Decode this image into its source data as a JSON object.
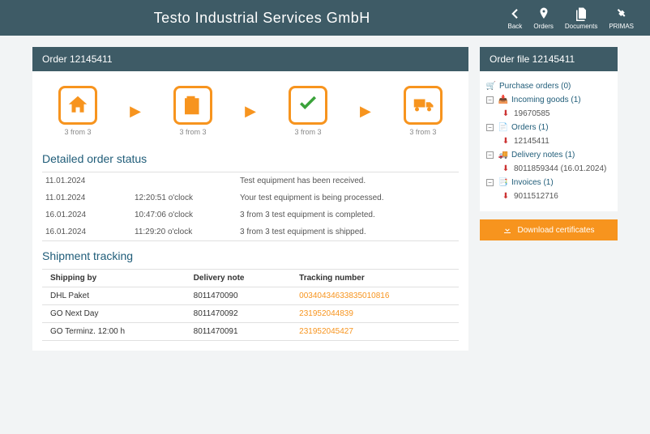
{
  "header": {
    "title": "Testo Industrial Services GmbH",
    "buttons": {
      "back": "Back",
      "orders": "Orders",
      "documents": "Documents",
      "primas": "PRIMAS"
    }
  },
  "order": {
    "panel_title": "Order 12145411",
    "steps": {
      "s0": "3 from 3",
      "s1": "3 from 3",
      "s2": "3 from 3",
      "s3": "3 from 3"
    },
    "detail_title": "Detailed order status",
    "status": {
      "r0": {
        "date": "11.01.2024",
        "time": "",
        "msg": "Test equipment has been received."
      },
      "r1": {
        "date": "11.01.2024",
        "time": "12:20:51 o'clock",
        "msg": "Your test equipment is being processed."
      },
      "r2": {
        "date": "16.01.2024",
        "time": "10:47:06 o'clock",
        "msg": "3 from 3 test equipment is completed."
      },
      "r3": {
        "date": "16.01.2024",
        "time": "11:29:20 o'clock",
        "msg": "3 from 3 test equipment is shipped."
      }
    },
    "ship_title": "Shipment tracking",
    "ship_headers": {
      "h0": "Shipping by",
      "h1": "Delivery note",
      "h2": "Tracking number"
    },
    "shipments": {
      "r0": {
        "carrier": "DHL Paket",
        "note": "8011470090",
        "tracking": "00340434633835010816"
      },
      "r1": {
        "carrier": "GO Next Day",
        "note": "8011470092",
        "tracking": "231952044839"
      },
      "r2": {
        "carrier": "GO Terminz. 12:00 h",
        "note": "8011470091",
        "tracking": "231952045427"
      }
    }
  },
  "file": {
    "panel_title": "Order file 12145411",
    "tree": {
      "po": "Purchase orders (0)",
      "incoming": "Incoming goods (1)",
      "incoming_child": "19670585",
      "orders": "Orders (1)",
      "orders_child": "12145411",
      "delivery": "Delivery notes (1)",
      "delivery_child": "8011859344 (16.01.2024)",
      "invoices": "Invoices (1)",
      "invoices_child": "9011512716"
    },
    "download": "Download certificates"
  }
}
